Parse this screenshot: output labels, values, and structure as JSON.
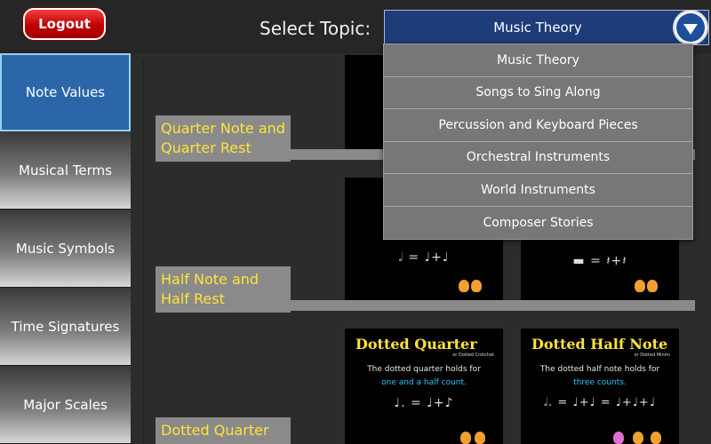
{
  "header": {
    "logout_label": "Logout",
    "select_label": "Select Topic:",
    "selected_topic": "Music Theory"
  },
  "dropdown": {
    "options": [
      "Music Theory",
      "Songs to Sing Along",
      "Percussion and Keyboard Pieces",
      "Orchestral Instruments",
      "World Instruments",
      "Composer Stories"
    ]
  },
  "sidebar": {
    "items": [
      {
        "label": "Note Values",
        "active": true
      },
      {
        "label": "Musical Terms",
        "active": false
      },
      {
        "label": "Music Symbols",
        "active": false
      },
      {
        "label": "Time Signatures",
        "active": false
      },
      {
        "label": "Major Scales",
        "active": false
      }
    ]
  },
  "sections": [
    {
      "label": "Quarter Note and Quarter Rest"
    },
    {
      "label": "Half Note and Half Rest"
    },
    {
      "label": "Dotted Quarter"
    }
  ],
  "cards": {
    "dotted_quarter": {
      "title": "Dotted Quarter",
      "subtitle": "or Dotted Crotchet",
      "desc": "The dotted quarter holds for",
      "count": "one and a half count."
    },
    "dotted_half": {
      "title": "Dotted Half Note",
      "subtitle": "or Dotted Minim",
      "desc": "The dotted half note holds for",
      "count": "three counts."
    }
  },
  "colors": {
    "accent_blue": "#1d3c78",
    "active_sidebar": "#2b66a8",
    "label_yellow": "#ffe33a",
    "logout_red": "#d00000",
    "count_cyan": "#2ec4ff"
  }
}
